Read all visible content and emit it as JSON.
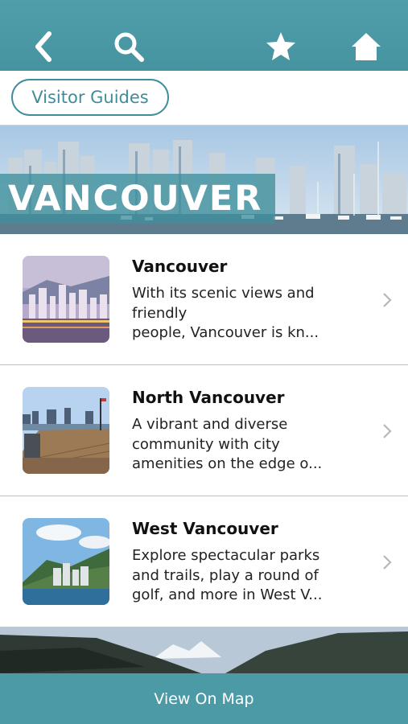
{
  "header": {
    "icons": [
      "back-chevron-icon",
      "search-icon",
      "star-icon",
      "home-icon"
    ],
    "accent_color": "#4b9aa6"
  },
  "guides_button": {
    "label": "Visitor Guides"
  },
  "hero": {
    "title": "VANCOUVER"
  },
  "items": [
    {
      "title": "Vancouver",
      "desc_lines": [
        "With its scenic views and",
        "friendly",
        "people, Vancouver is kn..."
      ]
    },
    {
      "title": "North Vancouver",
      "desc_lines": [
        "A vibrant and diverse",
        "community with city",
        "amenities on the edge o..."
      ]
    },
    {
      "title": "West Vancouver",
      "desc_lines": [
        "Explore spectacular parks",
        "and trails, play a round of",
        "golf, and more in West V..."
      ]
    }
  ],
  "footer": {
    "map_label": "View On Map"
  }
}
